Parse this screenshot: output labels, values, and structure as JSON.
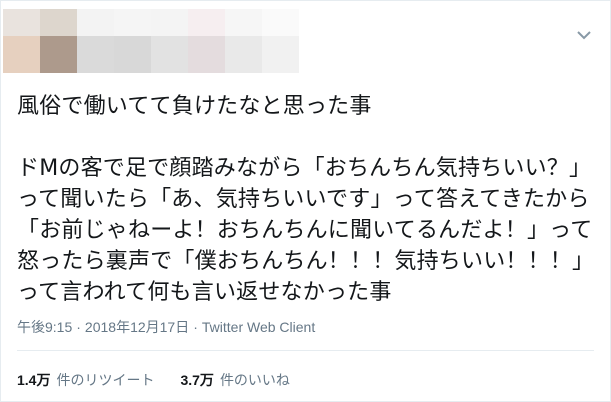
{
  "tweet": {
    "text": "風俗で働いてて負けたなと思った事\n\nドMの客で足で顔踏みながら「おちんちん気持ちいい？」って聞いたら「あ、気持ちいいです」って答えてきたから「お前じゃねーよ！おちんちんに聞いてるんだよ！」って怒ったら裏声で「僕おちんちん！！！気持ちいい！！！」って言われて何も言い返せなかった事",
    "time": "午後9:15",
    "date": "2018年12月17日",
    "client": "Twitter Web Client",
    "separator": "·"
  },
  "stats": {
    "retweets_count": "1.4万",
    "retweets_label": "件のリツイート",
    "likes_count": "3.7万",
    "likes_label": "件のいいね"
  },
  "icons": {
    "menu": "chevron-down-icon"
  }
}
